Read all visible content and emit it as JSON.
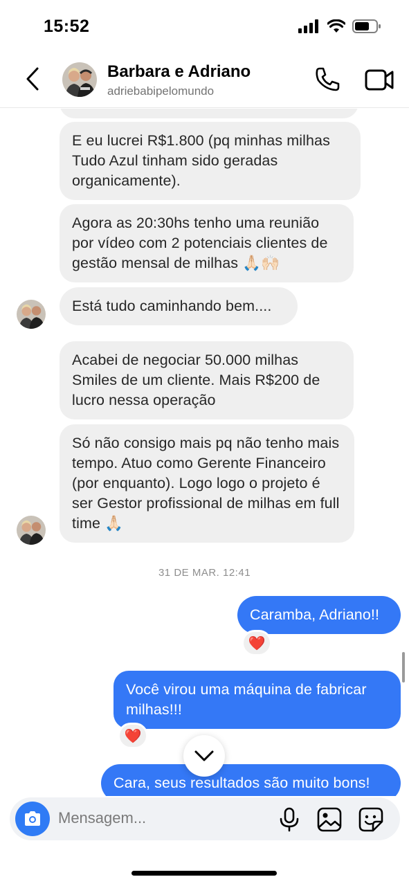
{
  "status": {
    "time": "15:52"
  },
  "header": {
    "title": "Barbara e Adriano",
    "subtitle": "adriebabipelomundo"
  },
  "messages": [
    {
      "dir": "in",
      "text": "E eu lucrei R$1.800 (pq minhas milhas Tudo Azul tinham sido geradas organicamente)."
    },
    {
      "dir": "in",
      "text": "Agora as 20:30hs tenho uma reunião por vídeo com 2 potenciais clientes de gestão mensal de milhas 🙏🏻🙌🏻"
    },
    {
      "dir": "in",
      "text": "Está tudo caminhando bem...."
    },
    {
      "dir": "in",
      "text": "Acabei de negociar 50.000 milhas Smiles de um cliente. Mais R$200 de lucro nessa operação"
    },
    {
      "dir": "in",
      "text": "Só não consigo mais pq não tenho mais tempo. Atuo como Gerente Financeiro (por enquanto). Logo logo o projeto é ser Gestor profissional de milhas em full time 🙏🏻"
    },
    {
      "dir": "out",
      "text": "Caramba, Adriano!!",
      "reaction": "❤️"
    },
    {
      "dir": "out",
      "text": "Você virou uma máquina de fabricar milhas!!!",
      "reaction": "❤️"
    },
    {
      "dir": "out",
      "text": "Cara, seus resultados são muito bons!"
    }
  ],
  "timestamp": "31 DE MAR. 12:41",
  "composer": {
    "placeholder": "Mensagem..."
  },
  "colors": {
    "outgoing": "#3478f6",
    "incoming": "#efefef",
    "camera": "#2f7bf5"
  }
}
